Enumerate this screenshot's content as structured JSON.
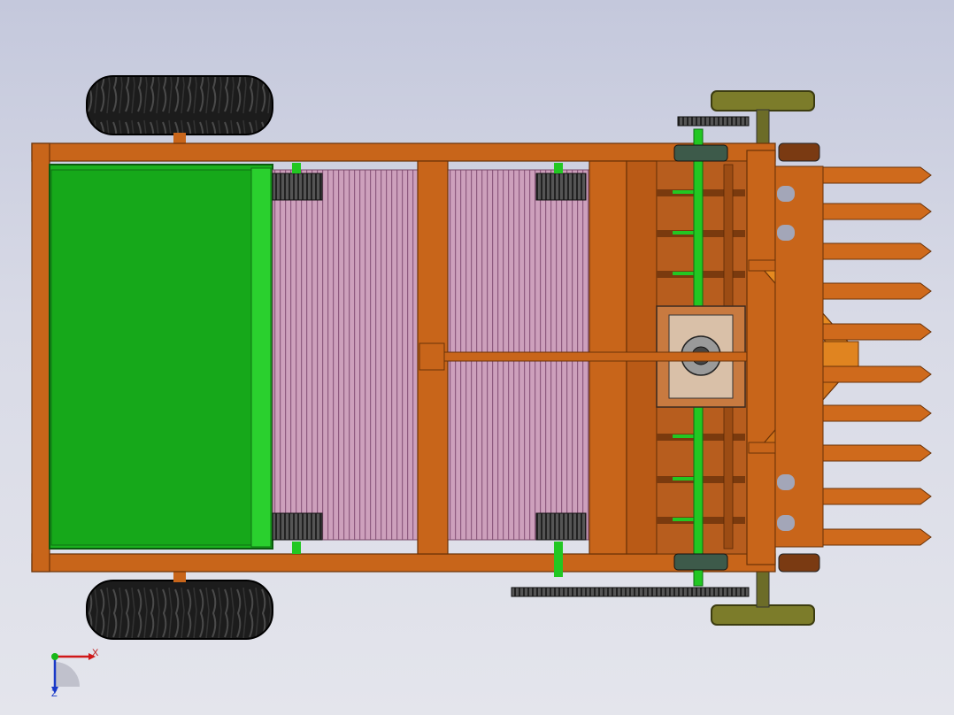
{
  "viewport": {
    "model": "root-crop-harvester",
    "view": "top",
    "background_colors": [
      "#c4c8dc",
      "#e4e5ec"
    ]
  },
  "colors": {
    "frame": "#c8651a",
    "frame_dark": "#8a4310",
    "hopper": "#19b31e",
    "hopper_edge": "#0e6e12",
    "conveyor": "#c997b5",
    "conveyor_line": "#8b4f7a",
    "tire": "#141414",
    "shaft": "#22c722",
    "wheel_rim": "#8a8a2a",
    "gear": "#3c3c3c"
  },
  "triad": {
    "x_label": "X",
    "z_label": "Z",
    "icon": "coordinate-triad-icon"
  }
}
